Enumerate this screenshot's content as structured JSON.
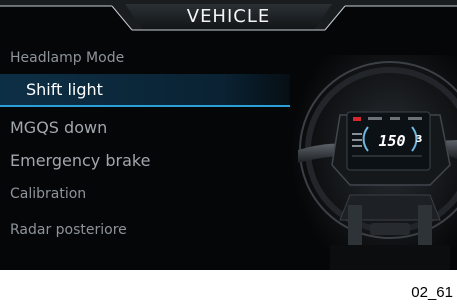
{
  "header": {
    "title": "VEHICLE"
  },
  "menu": {
    "items": [
      {
        "label": "Headlamp Mode",
        "selected": false
      },
      {
        "label": "Shift light",
        "selected": true
      },
      {
        "label": "MGQS down",
        "selected": false
      },
      {
        "label": "Emergency brake",
        "selected": false
      },
      {
        "label": "Calibration",
        "selected": false
      },
      {
        "label": "Radar posteriore",
        "selected": false
      }
    ]
  },
  "dashboard_display": {
    "speed": "150",
    "gear": "3"
  },
  "figure": {
    "code": "02_61"
  },
  "colors": {
    "background": "#050607",
    "accent_blue": "#2a9fd8",
    "menu_text": "#8d949a",
    "selected_text": "#ffffff"
  },
  "icons": [
    "motorcycle-dashboard-image"
  ]
}
